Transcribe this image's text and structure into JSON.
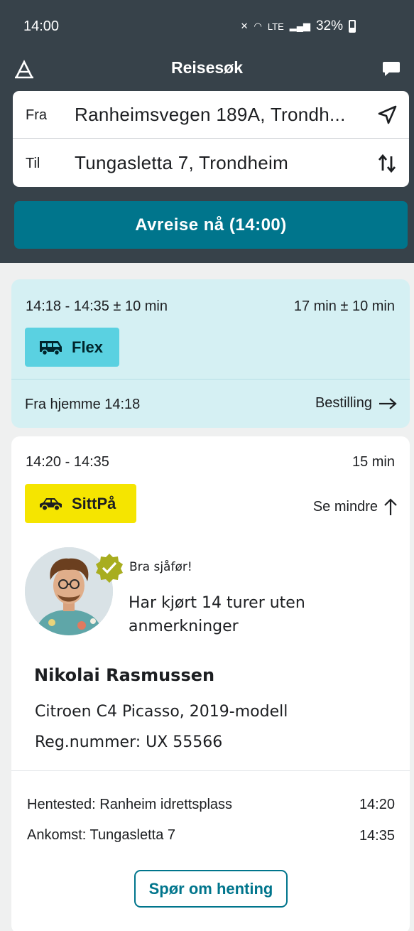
{
  "status_bar": {
    "time": "14:00",
    "network": "LTE",
    "battery": "32%"
  },
  "app_bar": {
    "title": "Reisesøk",
    "accessibility_icon": "text-size-icon",
    "chat_icon": "chat-bubble-icon"
  },
  "search": {
    "from_label": "Fra",
    "from_value": "Ranheimsvegen 189A, Trondh...",
    "to_label": "Til",
    "to_value": "Tungasletta 7, Trondheim",
    "location_icon": "navigation-arrow-icon",
    "swap_icon": "swap-vertical-icon"
  },
  "depart_button": "Avreise nå (14:00)",
  "trips": [
    {
      "time_range": "14:18 - 14:35 ± 10 min",
      "duration": "17 min ± 10 min",
      "tag": "Flex",
      "tag_icon": "bus-icon",
      "from_text": "Fra hjemme 14:18",
      "order_link": "Bestilling",
      "color": "#d5f0f3"
    },
    {
      "time_range": "14:20 - 14:35",
      "duration": "15 min",
      "tag": "SittPå",
      "tag_icon": "car-icon",
      "toggle_link": "Se mindre",
      "driver": {
        "badge_text": "Bra sjåfør!",
        "note": "Har kjørt 14 turer uten anmerkninger",
        "name": "Nikolai Rasmussen",
        "car": "Citroen C4 Picasso, 2019-modell",
        "reg": "Reg.nummer: UX 55566"
      },
      "pickup_label": "Hentested: Ranheim idrettsplass",
      "pickup_time": "14:20",
      "arrival_label": "Ankomst: Tungasletta 7",
      "arrival_time": "14:35",
      "ask_button": "Spør om henting"
    }
  ],
  "colors": {
    "header": "#37424a",
    "primary": "#00758c",
    "flex_tag": "#5ad1e1",
    "sitt_tag": "#f5e500"
  }
}
